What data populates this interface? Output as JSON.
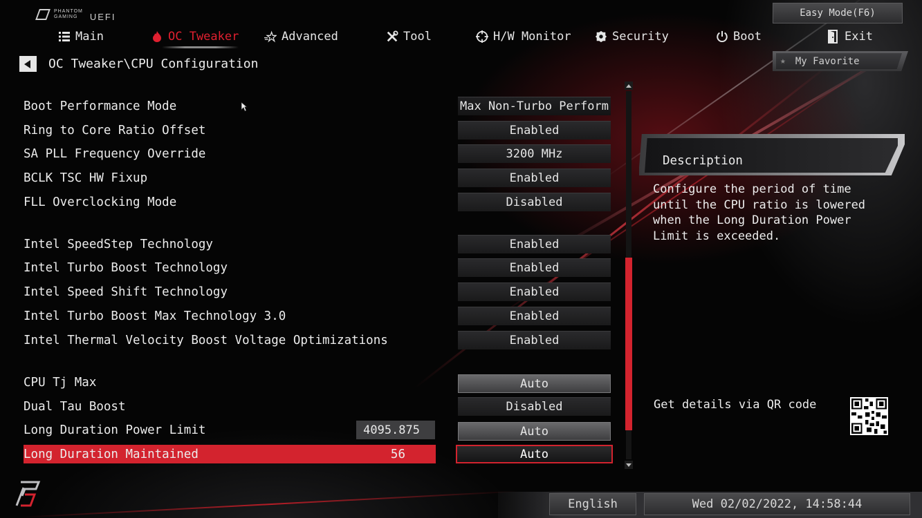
{
  "header": {
    "brand_line1": "PHANTOM",
    "brand_line2": "GAMING",
    "uefi": "UEFI",
    "easy_mode": "Easy Mode(F6)"
  },
  "nav": [
    {
      "label": "Main",
      "icon": "list-icon",
      "active": false
    },
    {
      "label": "OC Tweaker",
      "icon": "flame-icon",
      "active": true
    },
    {
      "label": "Advanced",
      "icon": "star-icon",
      "active": false
    },
    {
      "label": "Tool",
      "icon": "tools-icon",
      "active": false
    },
    {
      "label": "H/W Monitor",
      "icon": "crosshair-icon",
      "active": false
    },
    {
      "label": "Security",
      "icon": "shield-icon",
      "active": false
    },
    {
      "label": "Boot",
      "icon": "power-icon",
      "active": false
    },
    {
      "label": "Exit",
      "icon": "exit-door-icon",
      "active": false
    }
  ],
  "breadcrumb": "OC Tweaker\\CPU Configuration",
  "favorite": {
    "label": "My Favorite",
    "icon": "star-icon"
  },
  "settings": [
    {
      "label": "Boot Performance Mode",
      "value": "Max Non-Turbo Perform..."
    },
    {
      "label": "Ring to Core Ratio Offset",
      "value": "Enabled"
    },
    {
      "label": "SA PLL Frequency Override",
      "value": "3200 MHz"
    },
    {
      "label": "BCLK TSC HW Fixup",
      "value": "Enabled"
    },
    {
      "label": "FLL Overclocking Mode",
      "value": "Disabled"
    },
    {
      "label": "Intel SpeedStep Technology",
      "value": "Enabled"
    },
    {
      "label": "Intel Turbo Boost Technology",
      "value": "Enabled"
    },
    {
      "label": "Intel Speed Shift Technology",
      "value": "Enabled"
    },
    {
      "label": "Intel Turbo Boost Max Technology 3.0",
      "value": "Enabled"
    },
    {
      "label": "Intel Thermal Velocity Boost Voltage Optimizations",
      "value": "Enabled"
    },
    {
      "label": "CPU Tj Max",
      "value": "Auto"
    },
    {
      "label": "Dual Tau Boost",
      "value": "Disabled"
    },
    {
      "label": "Long Duration Power Limit",
      "value": "Auto",
      "number": "4095.875"
    },
    {
      "label": "Long Duration Maintained",
      "value": "Auto",
      "number": "56",
      "selected": true
    }
  ],
  "description": {
    "title": "Description",
    "text": "Configure the period of time until the CPU ratio is lowered when the Long Duration Power Limit is exceeded.",
    "qr_label": "Get details via QR code"
  },
  "footer": {
    "language": "English",
    "datetime": "Wed 02/02/2022, 14:58:44"
  },
  "colors": {
    "accent": "#d3232e",
    "active_tab": "#e02030",
    "background": "#050505"
  }
}
